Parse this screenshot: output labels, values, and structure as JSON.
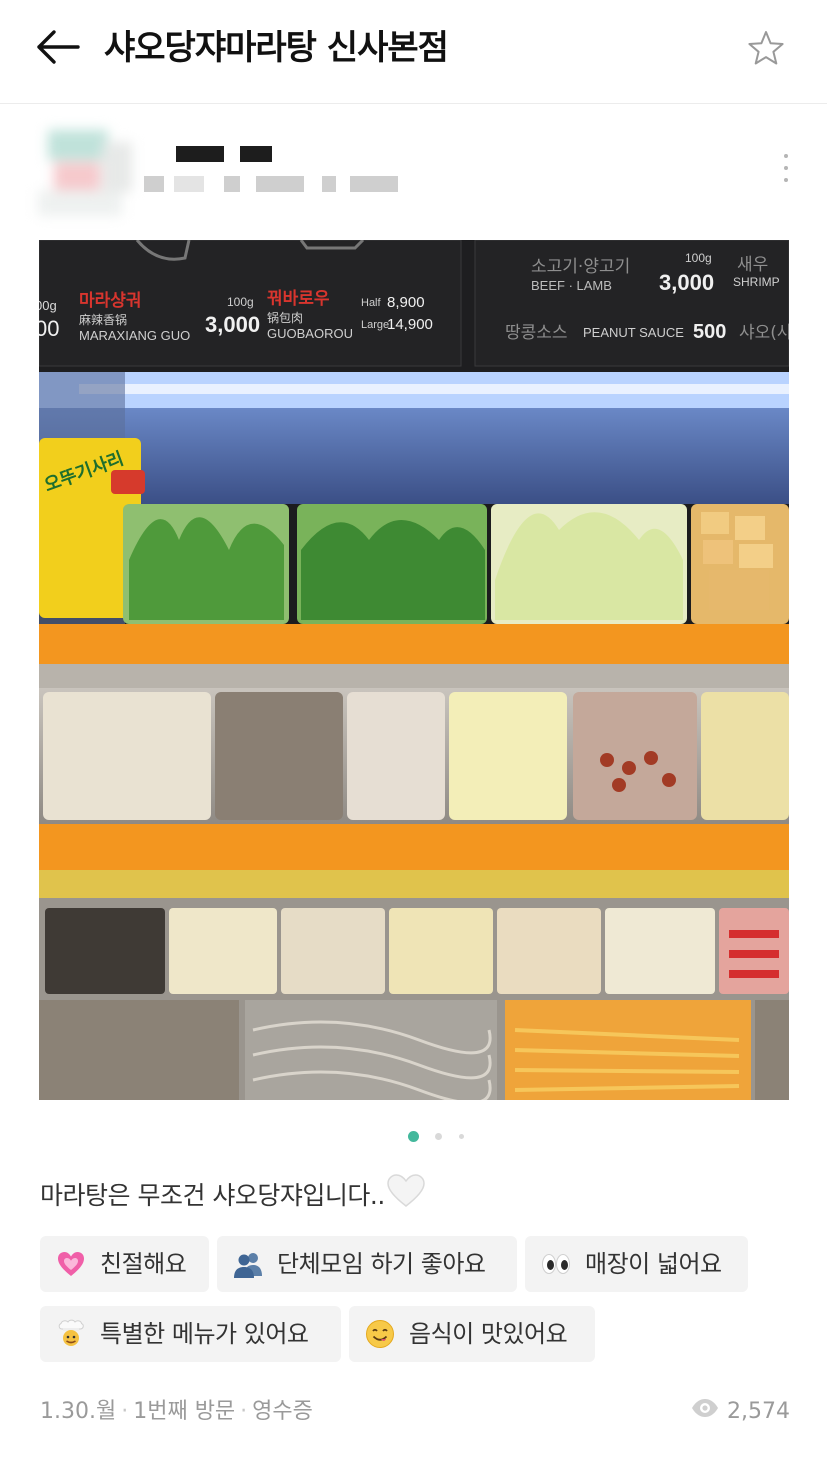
{
  "header": {
    "title": "샤오당쟈마라탕 신사본점"
  },
  "photo": {
    "menu_board": {
      "item1": {
        "name_ko": "마라샹궈",
        "name_cn": "麻辣香锅",
        "name_en": "MARAXIANG GUO",
        "weight": "100g",
        "price": "3,000",
        "cut_left_weight": "00g",
        "cut_left_price": "00"
      },
      "item2": {
        "name_ko": "꿔바로우",
        "name_cn": "锅包肉",
        "name_en": "GUOBAOROU",
        "half_label": "Half",
        "half_price": "8,900",
        "large_label": "Large",
        "large_price": "14,900"
      },
      "item3": {
        "name_ko": "소고기·양고기",
        "name_en": "BEEF · LAMB",
        "weight": "100g",
        "price": "3,000",
        "extra_ko": "새우",
        "extra_en": "SHRIMP"
      },
      "item4": {
        "name_ko": "땅콩소스",
        "name_en": "PEANUT SAUCE",
        "price": "500",
        "extra_ko": "샤오(사"
      }
    },
    "noodle_pack_text": "오뚜기사리"
  },
  "pagination": {
    "total": 3,
    "active_index": 0,
    "active_color": "#43b89c",
    "inactive_color": "#d9d9d9"
  },
  "review": {
    "text": "마라탕은 무조건 샤오당쟈입니다..",
    "emoji": "white-heart"
  },
  "keywords": [
    {
      "label": "친절해요",
      "icon": "sparkling-heart-icon"
    },
    {
      "label": "단체모임 하기 좋아요",
      "icon": "people-icon"
    },
    {
      "label": "매장이 넓어요",
      "icon": "eyes-icon"
    },
    {
      "label": "특별한 메뉴가 있어요",
      "icon": "chef-icon"
    },
    {
      "label": "음식이 맛있어요",
      "icon": "yum-face-icon"
    }
  ],
  "footer": {
    "date": "1.30.월",
    "visit": "1번째 방문",
    "receipt": "영수증",
    "views": "2,574"
  }
}
